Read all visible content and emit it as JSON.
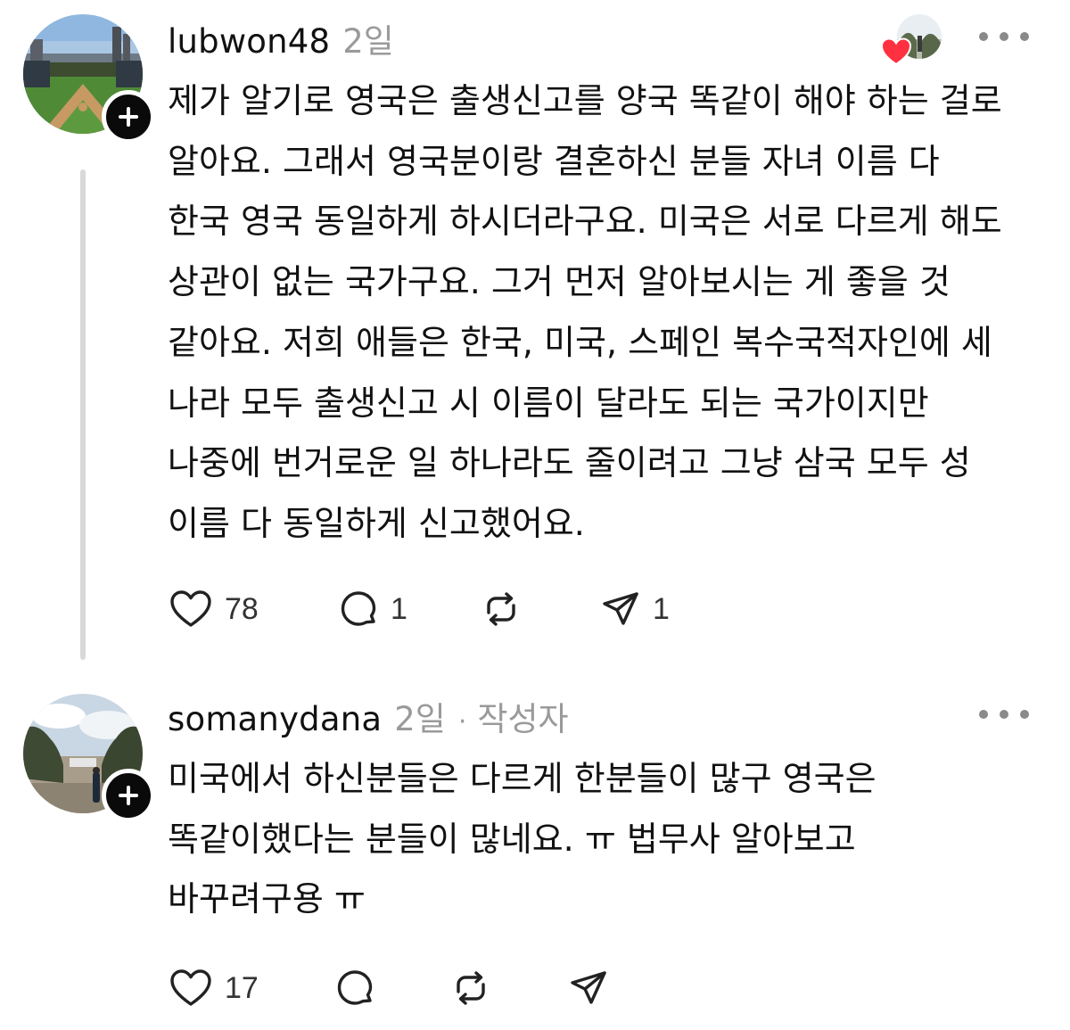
{
  "posts": [
    {
      "username": "lubwon48",
      "timestamp": "2일",
      "body_lines": [
        "제가 알기로 영국은 출생신고를 양국 똑같이 해야 하는 걸로",
        "알아요. 그래서 영국분이랑 결혼하신 분들 자녀 이름 다",
        "한국 영국 동일하게 하시더라구요. 미국은 서로 다르게 해도",
        "상관이 없는 국가구요. 그거 먼저 알아보시는 게 좋을 것",
        "같아요. 저희 애들은 한국, 미국, 스페인 복수국적자인에 세",
        "나라 모두 출생신고 시 이름이 달라도 되는 국가이지만",
        "나중에 번거로운 일 하나라도 줄이려고 그냥 삼국 모두 성",
        "이름 다 동일하게 신고했어요."
      ],
      "likes": "78",
      "replies": "1",
      "reposts": "",
      "shares": "1",
      "liked_by_indicator": "heart-icon",
      "colors": {
        "heart": "#ff3040",
        "follow_badge": "#0a0a0a"
      }
    },
    {
      "username": "somanydana",
      "timestamp": "2일",
      "separator": "·",
      "author_tag": "작성자",
      "body_lines": [
        "미국에서 하신분들은 다르게 한분들이 많구 영국은",
        "똑같이했다는 분들이 많네요. ㅠ 법무사 알아보고",
        "바꾸려구용 ㅠ"
      ],
      "likes": "17",
      "replies": "",
      "reposts": "",
      "shares": ""
    }
  ]
}
